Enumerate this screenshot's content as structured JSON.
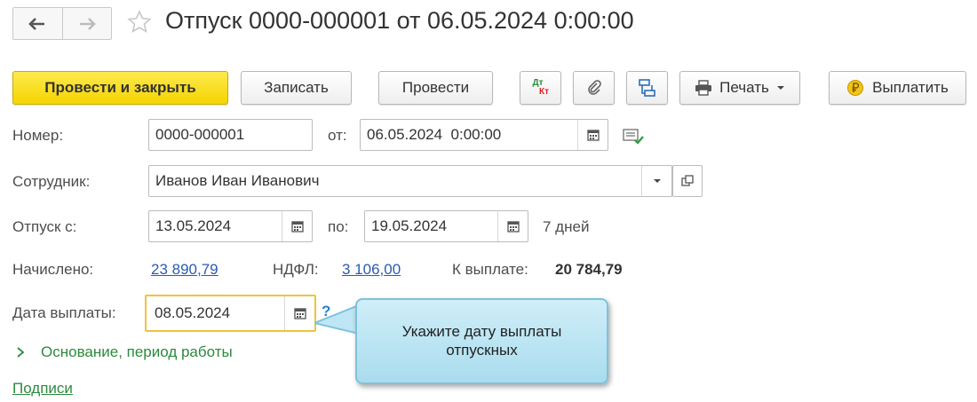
{
  "window": {
    "title": "Отпуск 0000-000001 от 06.05.2024 0:00:00"
  },
  "toolbar": {
    "post_close": "Провести и закрыть",
    "save": "Записать",
    "post": "Провести",
    "dtkt_top": "Дт",
    "dtkt_bottom": "Кт",
    "print": "Печать",
    "pay": "Выплатить"
  },
  "form": {
    "number_label": "Номер:",
    "number_value": "0000-000001",
    "from_label": "от:",
    "date_value": "06.05.2024  0:00:00",
    "employee_label": "Сотрудник:",
    "employee_value": "Иванов Иван Иванович",
    "vacation_label": "Отпуск с:",
    "vacation_from": "13.05.2024",
    "to_label": "по:",
    "vacation_to": "19.05.2024",
    "days": "7 дней",
    "accrued_label": "Начислено:",
    "accrued_value": "23 890,79",
    "ndfl_label": "НДФЛ:",
    "ndfl_value": "3 106,00",
    "payout_label": "К выплате:",
    "payout_value": "20 784,79",
    "pay_date_label": "Дата выплаты:",
    "pay_date_value": "08.05.2024",
    "help": "?",
    "basis_section": "Основание, период работы",
    "signatures": "Подписи"
  },
  "tooltip": {
    "line1": "Укажите дату выплаты",
    "line2": "отпускных"
  },
  "colors": {
    "primary_button": "#f5d400",
    "link": "#2a5bb0",
    "section_green": "#2c8a3e",
    "focus_border": "#f0c33c",
    "tooltip_bg": "#bfe6f4"
  }
}
